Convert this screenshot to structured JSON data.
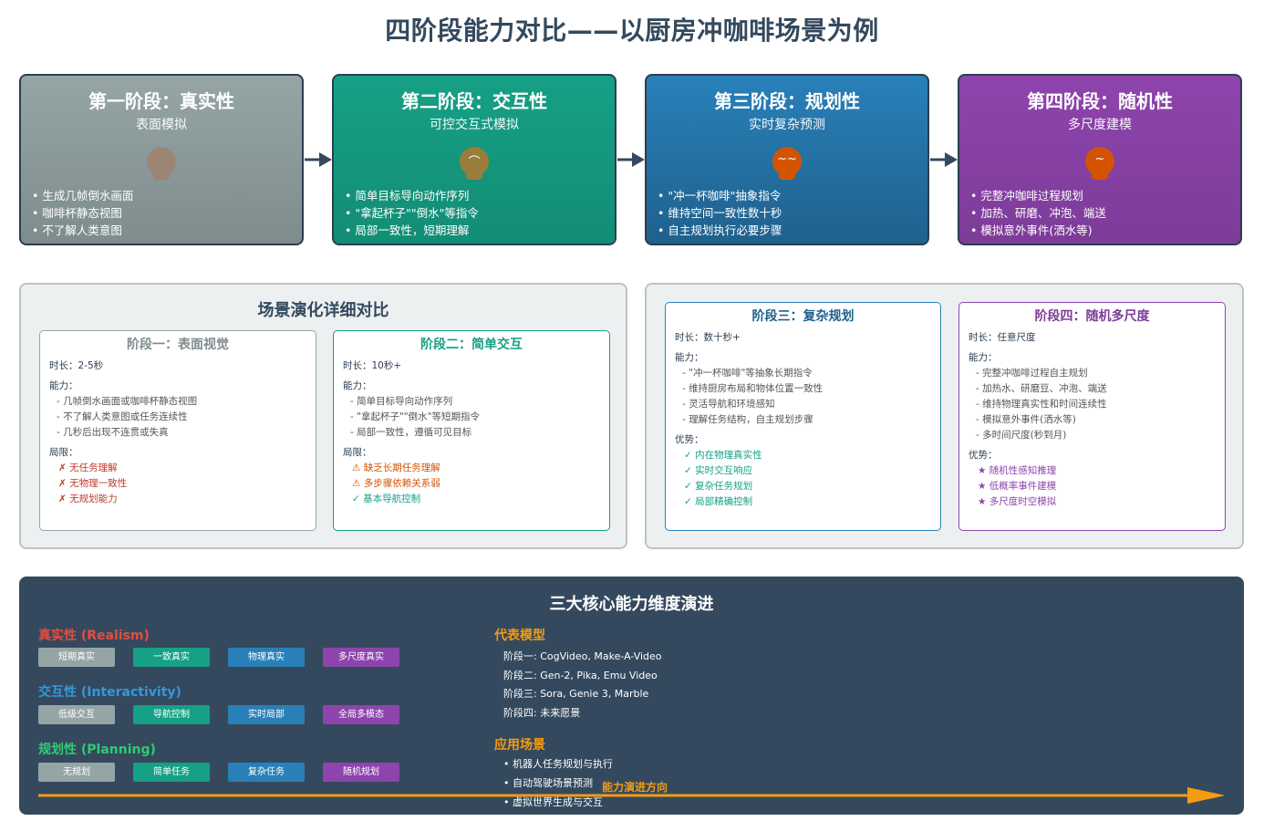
{
  "title": "四阶段能力对比——以厨房冲咖啡场景为例",
  "stages": [
    {
      "title": "第一阶段：真实性",
      "subtitle": "表面模拟",
      "icon": "coffee-cup-icon",
      "bullets": [
        "• 生成几帧倒水画面",
        "• 咖啡杯静态视图",
        "• 不了解人类意图"
      ]
    },
    {
      "title": "第二阶段：交互性",
      "subtitle": "可控交互式模拟",
      "icon": "coffee-cup-icon",
      "bullets": [
        "• 简单目标导向动作序列",
        "• \"拿起杯子\"\"倒水\"等指令",
        "• 局部一致性，短期理解"
      ]
    },
    {
      "title": "第三阶段：规划性",
      "subtitle": "实时复杂预测",
      "icon": "coffee-cup-icon",
      "bullets": [
        "• \"冲一杯咖啡\"抽象指令",
        "• 维持空间一致性数十秒",
        "• 自主规划执行必要步骤"
      ]
    },
    {
      "title": "第四阶段：随机性",
      "subtitle": "多尺度建模",
      "icon": "coffee-cup-icon",
      "bullets": [
        "• 完整冲咖啡过程规划",
        "• 加热、研磨、冲泡、端送",
        "• 模拟意外事件(洒水等)"
      ]
    }
  ],
  "comparison": {
    "title": "场景演化详细对比",
    "boxes": [
      {
        "title": "阶段一：表面视觉",
        "duration": "时长：2-5秒",
        "ability_label": "能力：",
        "abilities": [
          "- 几帧倒水画面或咖啡杯静态视图",
          "- 不了解人类意图或任务连续性",
          "- 几秒后出现不连贯或失真"
        ],
        "extra_label": "局限：",
        "extras": [
          "✗ 无任务理解",
          "✗ 无物理一致性",
          "✗ 无规划能力"
        ]
      },
      {
        "title": "阶段二：简单交互",
        "duration": "时长：10秒+",
        "ability_label": "能力：",
        "abilities": [
          "- 简单目标导向动作序列",
          "- \"拿起杯子\"\"倒水\"等短期指令",
          "- 局部一致性，遵循可见目标"
        ],
        "extra_label": "局限：",
        "extras": [
          "⚠ 缺乏长期任务理解",
          "⚠ 多步骤依赖关系弱",
          "✓ 基本导航控制"
        ]
      },
      {
        "title": "阶段三：复杂规划",
        "duration": "时长：数十秒+",
        "ability_label": "能力：",
        "abilities": [
          "- \"冲一杯咖啡\"等抽象长期指令",
          "- 维持厨房布局和物体位置一致性",
          "- 灵活导航和环境感知",
          "- 理解任务结构，自主规划步骤"
        ],
        "extra_label": "优势：",
        "extras": [
          "✓ 内在物理真实性",
          "✓ 实时交互响应",
          "✓ 复杂任务规划",
          "✓ 局部精确控制"
        ]
      },
      {
        "title": "阶段四：随机多尺度",
        "duration": "时长：任意尺度",
        "ability_label": "能力：",
        "abilities": [
          "- 完整冲咖啡过程自主规划",
          "- 加热水、研磨豆、冲泡、端送",
          "- 维持物理真实性和时间连续性",
          "- 模拟意外事件(洒水等)",
          "- 多时间尺度(秒到月)"
        ],
        "extra_label": "优势：",
        "extras": [
          "★ 随机性感知推理",
          "★ 低概率事件建模",
          "★ 多尺度时空模拟"
        ]
      }
    ]
  },
  "evolution": {
    "title": "三大核心能力维度演进",
    "dimensions": [
      {
        "label": "真实性 (Realism)",
        "color": "#e74c3c",
        "chips": [
          "短期真实",
          "一致真实",
          "物理真实",
          "多尺度真实"
        ]
      },
      {
        "label": "交互性 (Interactivity)",
        "color": "#3498db",
        "chips": [
          "低级交互",
          "导航控制",
          "实时局部",
          "全局多模态"
        ]
      },
      {
        "label": "规划性 (Planning)",
        "color": "#2ecc71",
        "chips": [
          "无规划",
          "简单任务",
          "复杂任务",
          "随机规划"
        ]
      }
    ],
    "models_title": "代表模型",
    "models": [
      "阶段一: CogVideo, Make-A-Video",
      "阶段二: Gen-2, Pika, Emu Video",
      "阶段三: Sora, Genie 3, Marble",
      "阶段四: 未来愿景"
    ],
    "apps_title": "应用场景",
    "apps": [
      "• 机器人任务规划与执行",
      "• 自动驾驶场景预测",
      "• 虚拟世界生成与交互"
    ],
    "direction_label": "能力演进方向"
  },
  "colors": {
    "realism": "#e74c3c",
    "interactivity": "#3498db",
    "planning": "#2ecc71",
    "accent": "#f39c12"
  }
}
